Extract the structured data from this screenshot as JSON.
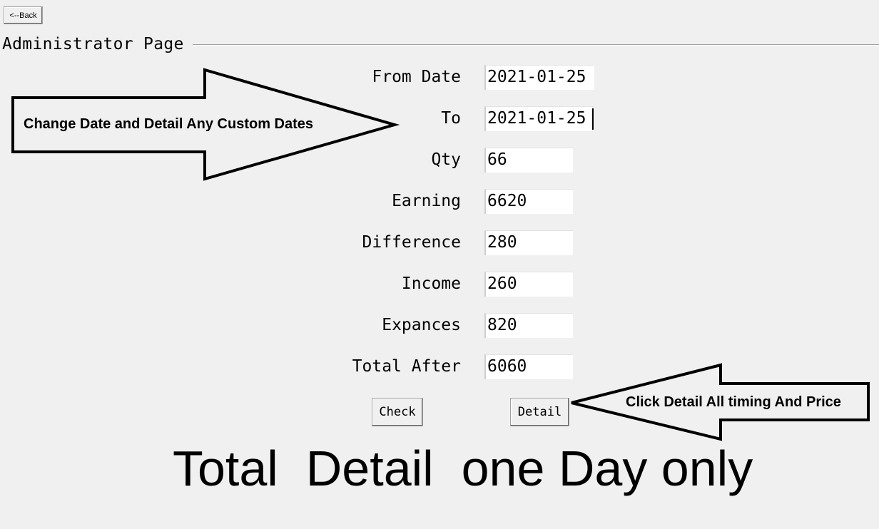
{
  "back_button": {
    "label": "<--Back"
  },
  "page_title": "Administrator Page",
  "form": {
    "from_date": {
      "label": "From Date",
      "value": "2021-01-25"
    },
    "to_date": {
      "label": "To",
      "value": "2021-01-25"
    },
    "qty": {
      "label": "Qty",
      "value": "66"
    },
    "earning": {
      "label": "Earning",
      "value": "6620"
    },
    "difference": {
      "label": "Difference",
      "value": "280"
    },
    "income": {
      "label": "Income",
      "value": "260"
    },
    "expances": {
      "label": "Expances",
      "value": "820"
    },
    "total_after": {
      "label": "Total After",
      "value": "6060"
    }
  },
  "buttons": {
    "check": "Check",
    "detail": "Detail"
  },
  "annotations": {
    "left_arrow_text": "Change Date and Detail Any Custom Dates",
    "right_arrow_text": "Click Detail All timing And Price",
    "caption": "Total  Detail  one Day only"
  }
}
